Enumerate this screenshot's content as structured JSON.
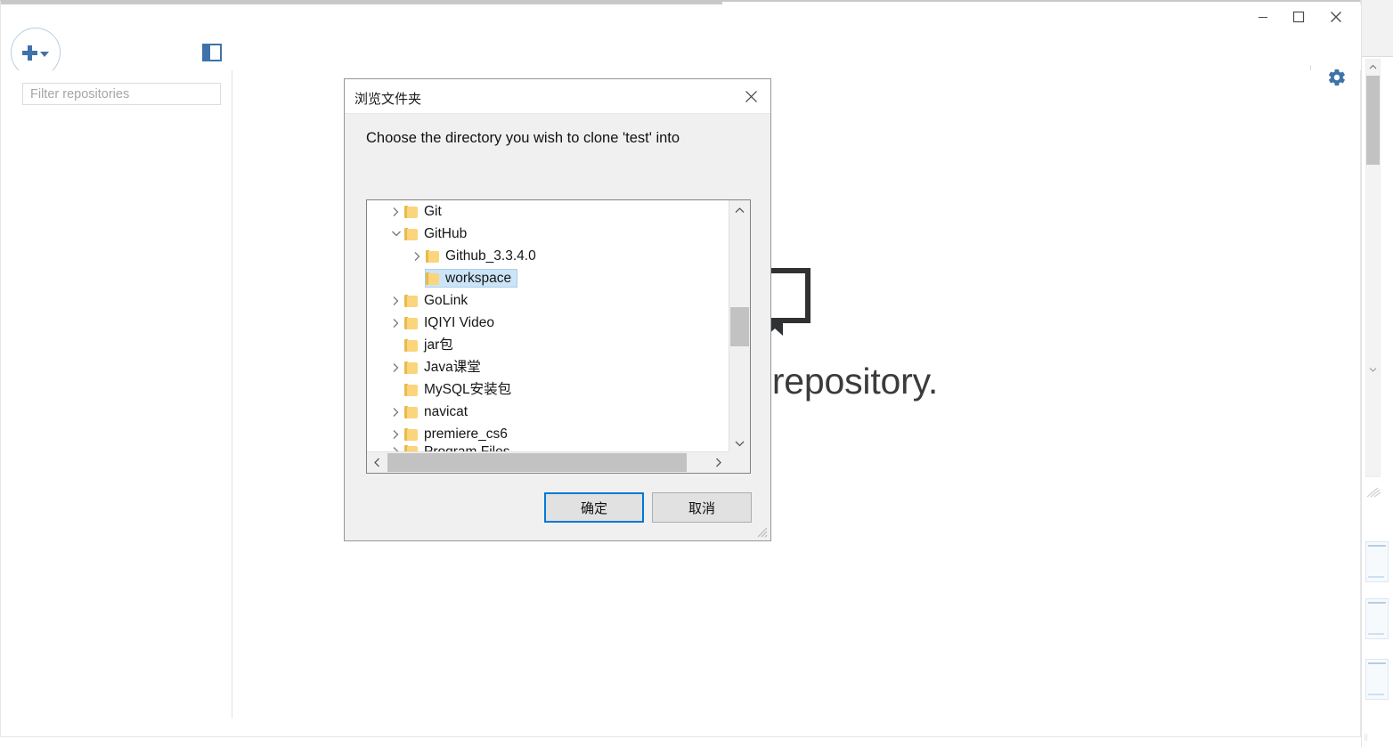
{
  "app": {
    "window_controls": {
      "minimize": "minimize-icon",
      "maximize": "maximize-icon",
      "close": "close-icon"
    },
    "toolbar": {
      "add_repo_label": "+",
      "add_repo_icon": "plus-with-caret-icon",
      "sidebar_toggle_icon": "sidebar-toggle-icon",
      "settings_icon": "gear-icon",
      "accent_color": "#3f72a8"
    },
    "sidebar": {
      "filter_placeholder": "Filter repositories",
      "filter_value": ""
    },
    "blank_slate": {
      "icon": "repository-book-icon",
      "title": "adding a repository."
    }
  },
  "dialog": {
    "title": "浏览文件夹",
    "close_icon": "close-icon",
    "prompt": "Choose the directory you wish to clone 'test' into",
    "selection_color": "#cce4f7",
    "focus_color": "#0078d7",
    "tree": [
      {
        "label": "Git",
        "indent": 1,
        "expander": "collapsed",
        "selected": false
      },
      {
        "label": "GitHub",
        "indent": 1,
        "expander": "expanded",
        "selected": false
      },
      {
        "label": "Github_3.3.4.0",
        "indent": 2,
        "expander": "collapsed",
        "selected": false
      },
      {
        "label": "workspace",
        "indent": 2,
        "expander": "none",
        "selected": true
      },
      {
        "label": "GoLink",
        "indent": 1,
        "expander": "collapsed",
        "selected": false
      },
      {
        "label": "IQIYI Video",
        "indent": 1,
        "expander": "collapsed",
        "selected": false
      },
      {
        "label": "jar包",
        "indent": 1,
        "expander": "none",
        "selected": false
      },
      {
        "label": "Java课堂",
        "indent": 1,
        "expander": "collapsed",
        "selected": false
      },
      {
        "label": "MySQL安装包",
        "indent": 1,
        "expander": "none",
        "selected": false
      },
      {
        "label": "navicat",
        "indent": 1,
        "expander": "collapsed",
        "selected": false
      },
      {
        "label": "premiere_cs6",
        "indent": 1,
        "expander": "collapsed",
        "selected": false
      },
      {
        "label": "Program Files",
        "indent": 1,
        "expander": "collapsed",
        "selected": false
      }
    ],
    "buttons": {
      "ok": "确定",
      "cancel": "取消"
    },
    "scrollbars": {
      "vertical_up": "chevron-up-icon",
      "vertical_down": "chevron-down-icon",
      "horizontal_left": "chevron-left-icon",
      "horizontal_right": "chevron-right-icon"
    }
  }
}
